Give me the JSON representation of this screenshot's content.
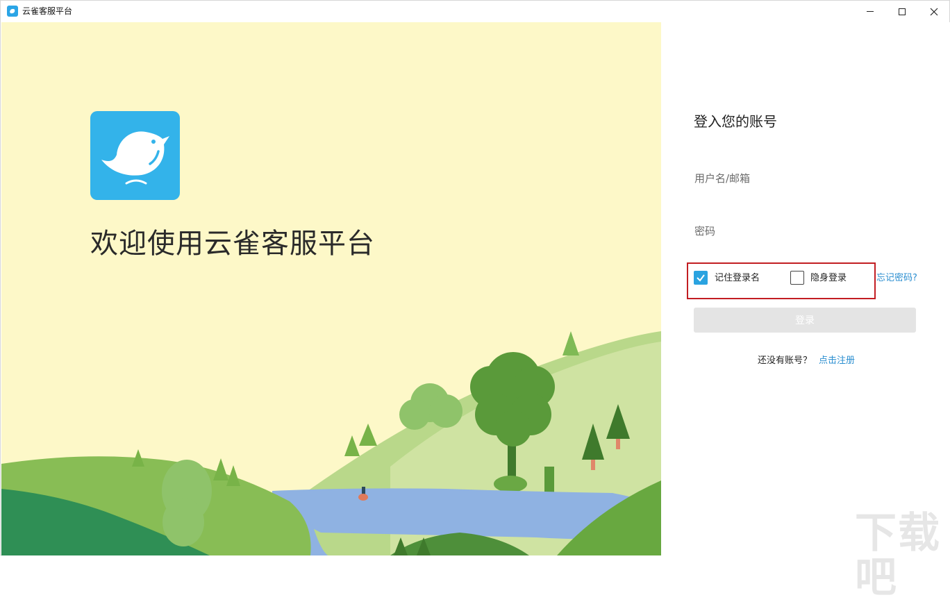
{
  "window": {
    "title": "云雀客服平台",
    "controls": {
      "minimize": "minimize",
      "maximize": "maximize",
      "close": "close"
    }
  },
  "hero": {
    "welcome_text": "欢迎使用云雀客服平台",
    "logo_color": "#33b3ea"
  },
  "login": {
    "title": "登入您的账号",
    "username_placeholder": "用户名/邮箱",
    "username_value": "",
    "password_placeholder": "密码",
    "password_value": "",
    "remember_label": "记住登录名",
    "remember_checked": true,
    "incognito_label": "隐身登录",
    "incognito_checked": false,
    "forgot_label": "忘记密码?",
    "submit_label": "登录",
    "no_account_text": "还没有账号？",
    "register_label": "点击注册"
  },
  "watermark": "下载吧",
  "colors": {
    "accent": "#2aa3e0",
    "link": "#2a8ed0",
    "highlight": "#c21d22",
    "background": "#fdf8c8"
  }
}
